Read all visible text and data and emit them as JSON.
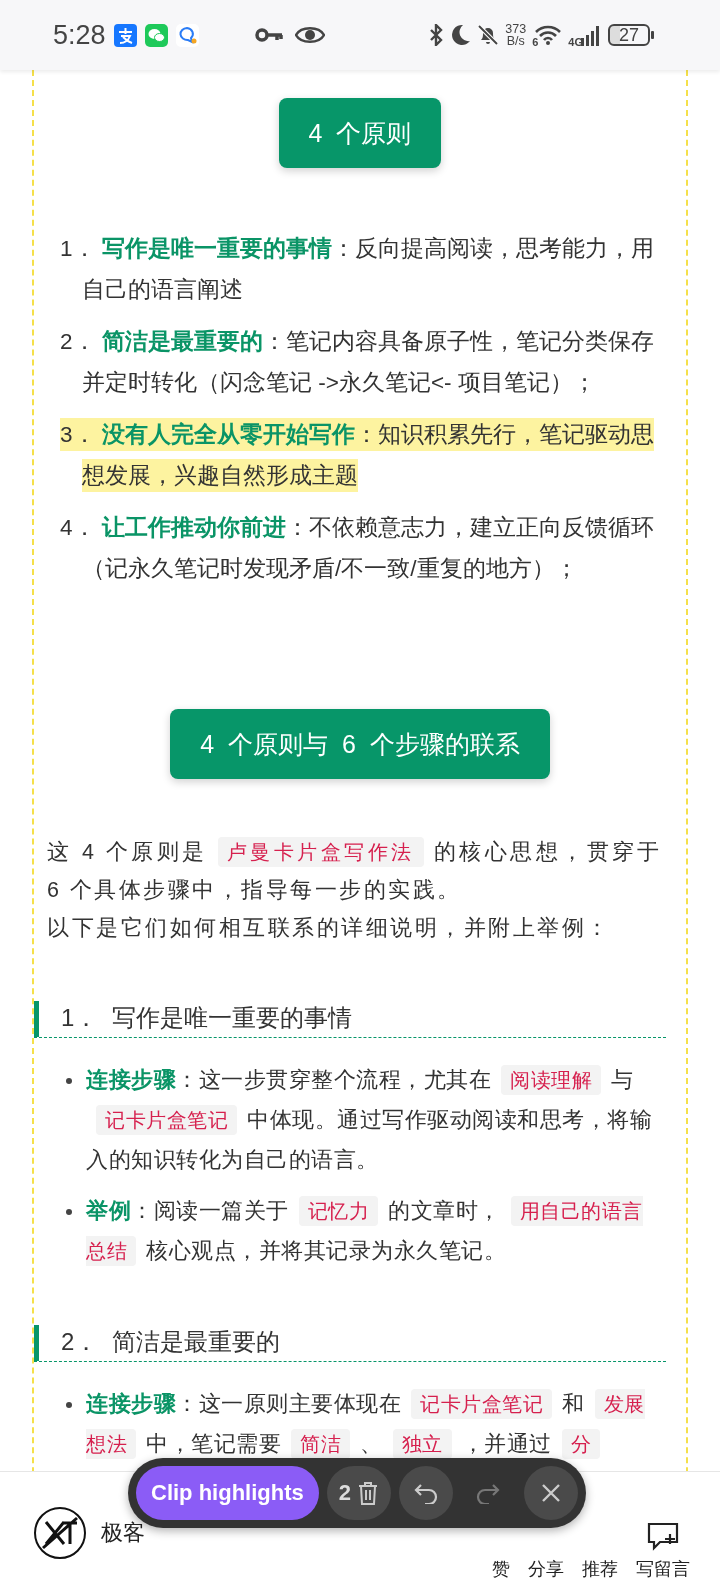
{
  "status_bar": {
    "time": "5:28",
    "net_speed": "373",
    "net_unit": "B/s",
    "wifi_tag": "6",
    "network": "4G",
    "battery": "27"
  },
  "article": {
    "blocks": [
      {
        "kind": "banner",
        "text": "4  个原则"
      },
      {
        "kind": "numbered_list",
        "items": [
          {
            "number": "1．",
            "highlighted": false,
            "segments": [
              {
                "kind": "term",
                "text": "写作是唯一重要的事情"
              },
              {
                "kind": "text",
                "text": "：反向提高阅读，思考能力，用自己的语言阐述"
              }
            ]
          },
          {
            "number": "2．",
            "highlighted": false,
            "segments": [
              {
                "kind": "term",
                "text": "简洁是最重要的"
              },
              {
                "kind": "text",
                "text": "：笔记内容具备原子性，笔记分类保存并定时转化（闪念笔记 ->永久笔记<- 项目笔记）；"
              }
            ]
          },
          {
            "number": "3．",
            "highlighted": true,
            "segments": [
              {
                "kind": "term",
                "text": "没有人完全从零开始写作"
              },
              {
                "kind": "text",
                "text": "：知识积累先行，笔记驱动思想发展，兴趣自然形成主题"
              }
            ]
          },
          {
            "number": "4．",
            "highlighted": false,
            "segments": [
              {
                "kind": "term",
                "text": "让工作推动你前进"
              },
              {
                "kind": "text",
                "text": "：不依赖意志力，建立正向反馈循环（记永久笔记时发现矛盾/不一致/重复的地方）；"
              }
            ]
          }
        ]
      },
      {
        "kind": "banner",
        "text": "4  个原则与  6  个步骤的联系"
      },
      {
        "kind": "paragraph",
        "lines": [
          [
            {
              "kind": "text",
              "text": "这  4  个原则是"
            },
            {
              "kind": "code",
              "text": "卢曼卡片盒写作法"
            },
            {
              "kind": "text",
              "text": "的核心思想，贯穿于  6  个具体步骤中，指导每一步的实践。"
            }
          ],
          [
            {
              "kind": "text",
              "text": "以下是它们如何相互联系的详细说明，并附上举例："
            }
          ]
        ]
      },
      {
        "kind": "heading",
        "number": "1．",
        "text": "写作是唯一重要的事情"
      },
      {
        "kind": "bullets",
        "items": [
          [
            {
              "kind": "term",
              "text": "连接步骤"
            },
            {
              "kind": "text",
              "text": "：这一步贯穿整个流程，尤其在"
            },
            {
              "kind": "code",
              "text": "阅读理解"
            },
            {
              "kind": "text",
              "text": "与"
            },
            {
              "kind": "code",
              "text": "记卡片盒笔记"
            },
            {
              "kind": "text",
              "text": "中体现。通过写作驱动阅读和思考，将输入的知识转化为自己的语言。"
            }
          ],
          [
            {
              "kind": "term",
              "text": "举例"
            },
            {
              "kind": "text",
              "text": "：阅读一篇关于"
            },
            {
              "kind": "code",
              "text": "记忆力"
            },
            {
              "kind": "text",
              "text": "的文章时，"
            },
            {
              "kind": "code",
              "text": "用自己的语言总结"
            },
            {
              "kind": "text",
              "text": "核心观点，并将其记录为永久笔记。"
            }
          ]
        ]
      },
      {
        "kind": "heading",
        "number": "2．",
        "text": "简洁是最重要的"
      },
      {
        "kind": "bullets",
        "items": [
          [
            {
              "kind": "term",
              "text": "连接步骤"
            },
            {
              "kind": "text",
              "text": "：这一原则主要体现在"
            },
            {
              "kind": "code",
              "text": "记卡片盒笔记"
            },
            {
              "kind": "text",
              "text": "和"
            },
            {
              "kind": "code",
              "text": "发展想法"
            },
            {
              "kind": "text",
              "text": "中，笔记需要"
            },
            {
              "kind": "code",
              "text": "简洁"
            },
            {
              "kind": "text",
              "text": "、"
            },
            {
              "kind": "code",
              "text": "独立"
            },
            {
              "kind": "text",
              "text": "，并通过"
            },
            {
              "kind": "code",
              "text": "分"
            }
          ]
        ]
      }
    ]
  },
  "author_bar": {
    "name": "极客",
    "actions": [
      {
        "kind": "plain",
        "label": "赞"
      },
      {
        "kind": "plain",
        "label": "分享"
      },
      {
        "kind": "plain",
        "label": "推荐"
      },
      {
        "kind": "comment",
        "label": "写留言"
      }
    ]
  },
  "clip_toolbar": {
    "label": "Clip highlights",
    "count": "2",
    "redo_disabled": true
  }
}
